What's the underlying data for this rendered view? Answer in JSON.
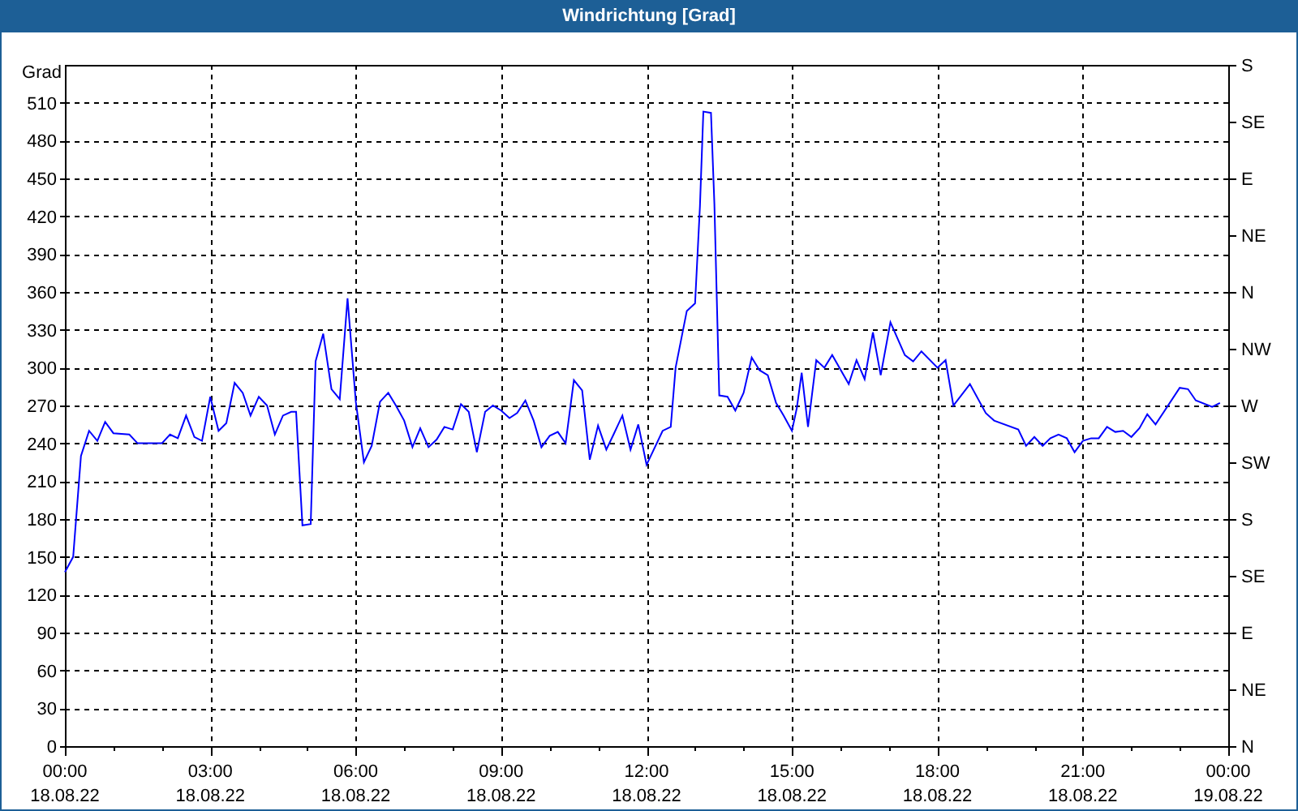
{
  "window": {
    "title": "Windrichtung [Grad]"
  },
  "chart": {
    "chart_data": {
      "type": "line",
      "grid": true,
      "ylabel": "Grad",
      "xlim": [
        0,
        24
      ],
      "ylim": [
        0,
        540
      ],
      "xticks": [
        {
          "value": 0,
          "label": "00:00"
        },
        {
          "value": 3,
          "label": "03:00"
        },
        {
          "value": 6,
          "label": "06:00"
        },
        {
          "value": 9,
          "label": "09:00"
        },
        {
          "value": 12,
          "label": "12:00"
        },
        {
          "value": 15,
          "label": "15:00"
        },
        {
          "value": 18,
          "label": "18:00"
        },
        {
          "value": 21,
          "label": "21:00"
        },
        {
          "value": 24,
          "label": "00:00"
        }
      ],
      "yticks": [
        0,
        30,
        60,
        90,
        120,
        150,
        180,
        210,
        240,
        270,
        300,
        330,
        360,
        390,
        420,
        450,
        480,
        510
      ],
      "x": [
        0,
        0.17,
        0.33,
        0.5,
        0.67,
        0.83,
        1,
        1.33,
        1.5,
        2,
        2.17,
        2.33,
        2.5,
        2.67,
        2.83,
        3,
        3.17,
        3.33,
        3.5,
        3.67,
        3.83,
        4,
        4.17,
        4.33,
        4.5,
        4.67,
        4.77,
        4.9,
        5.07,
        5.17,
        5.33,
        5.5,
        5.67,
        5.83,
        6,
        6.17,
        6.33,
        6.5,
        6.67,
        6.83,
        7,
        7.17,
        7.33,
        7.5,
        7.67,
        7.83,
        8,
        8.17,
        8.33,
        8.5,
        8.67,
        8.83,
        9,
        9.17,
        9.33,
        9.5,
        9.67,
        9.83,
        10,
        10.17,
        10.33,
        10.5,
        10.67,
        10.83,
        11,
        11.17,
        11.33,
        11.5,
        11.67,
        11.83,
        12,
        12.33,
        12.5,
        12.6,
        12.83,
        13,
        13.1,
        13.17,
        13.33,
        13.4,
        13.5,
        13.67,
        13.83,
        14,
        14.17,
        14.33,
        14.5,
        14.67,
        14.83,
        15,
        15.1,
        15.2,
        15.33,
        15.5,
        15.67,
        15.83,
        16.17,
        16.33,
        16.5,
        16.67,
        16.83,
        17.03,
        17.33,
        17.5,
        17.67,
        18,
        18.17,
        18.33,
        18.67,
        19,
        19.17,
        19.67,
        19.83,
        20,
        20.17,
        20.33,
        20.5,
        20.67,
        20.83,
        21,
        21.17,
        21.33,
        21.5,
        21.67,
        21.83,
        22,
        22.17,
        22.33,
        22.5,
        23,
        23.17,
        23.33,
        23.67,
        23.83
      ],
      "series": [
        {
          "color": "#0000ff",
          "values": [
            138,
            150,
            230,
            250,
            242,
            257,
            248,
            247,
            240,
            240,
            247,
            244,
            262,
            245,
            242,
            277,
            250,
            256,
            288,
            280,
            262,
            277,
            270,
            247,
            262,
            265,
            265,
            175,
            176,
            305,
            327,
            283,
            275,
            355,
            273,
            225,
            238,
            273,
            280,
            270,
            258,
            237,
            252,
            237,
            243,
            253,
            251,
            271,
            265,
            233,
            265,
            270,
            266,
            260,
            264,
            274,
            258,
            237,
            246,
            249,
            240,
            290,
            282,
            227,
            254,
            235,
            248,
            262,
            235,
            255,
            223,
            250,
            253,
            300,
            345,
            351,
            428,
            503,
            502,
            430,
            278,
            277,
            266,
            280,
            308,
            298,
            294,
            272,
            262,
            250,
            268,
            296,
            253,
            306,
            300,
            310,
            287,
            306,
            291,
            328,
            294,
            336,
            310,
            305,
            313,
            300,
            306,
            270,
            287,
            264,
            258,
            251,
            238,
            245,
            238,
            244,
            247,
            244,
            233,
            242,
            244,
            244,
            253,
            249,
            250,
            245,
            252,
            263,
            255,
            284,
            283,
            274,
            269,
            272
          ]
        }
      ]
    },
    "date_labels": [
      "18.08.22",
      "18.08.22",
      "18.08.22",
      "18.08.22",
      "18.08.22",
      "18.08.22",
      "18.08.22",
      "18.08.22",
      "19.08.22"
    ],
    "compass_axis": {
      "labels": [
        "S",
        "SE",
        "E",
        "NE",
        "N",
        "NW",
        "W",
        "SW",
        "S",
        "SE",
        "E",
        "NE",
        "N"
      ]
    }
  }
}
